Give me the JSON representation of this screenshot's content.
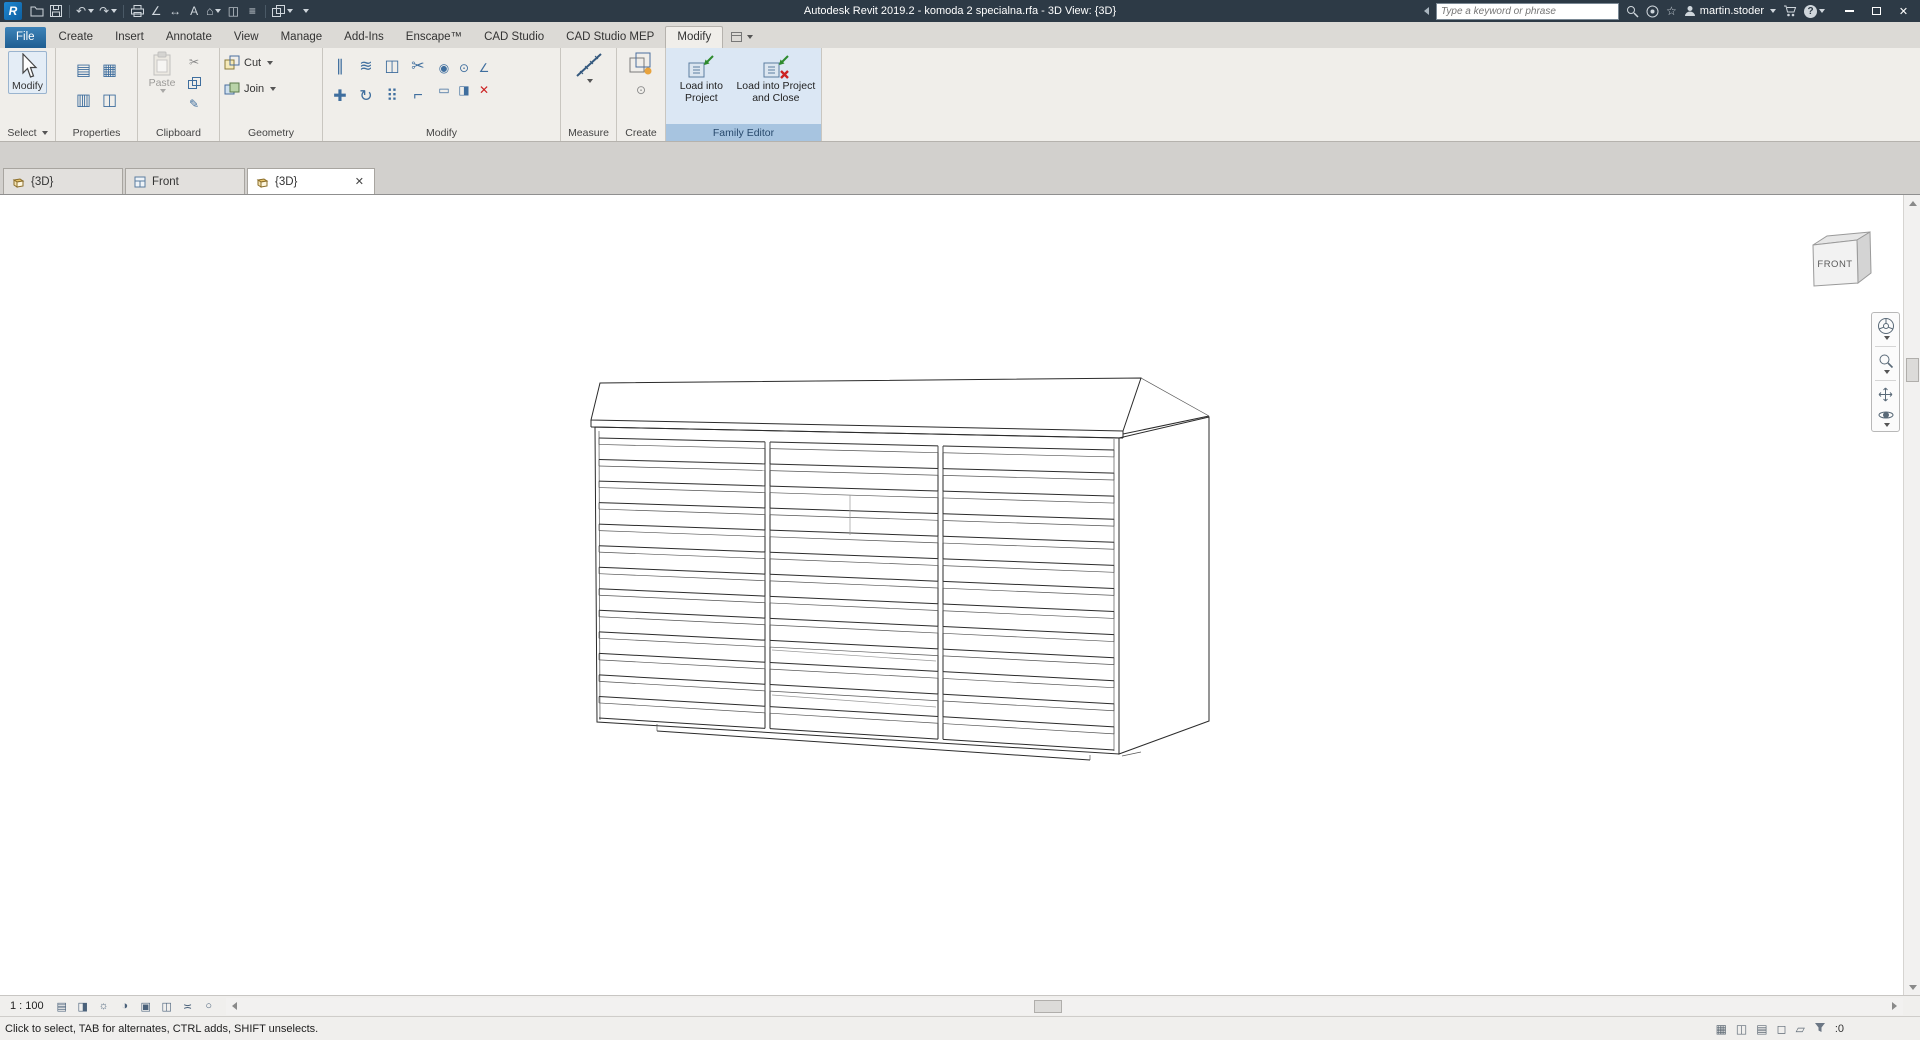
{
  "title_bar": {
    "logo": "R",
    "app_title": "Autodesk Revit 2019.2 - komoda 2 specialna.rfa - 3D View: {3D}",
    "search": {
      "placeholder": "Type a keyword or phrase"
    },
    "user": {
      "name": "martin.stoder"
    }
  },
  "icons": {
    "close": "✕",
    "help": "?"
  },
  "ribbon": {
    "tabs": [
      {
        "label": "File"
      },
      {
        "label": "Create"
      },
      {
        "label": "Insert"
      },
      {
        "label": "Annotate"
      },
      {
        "label": "View"
      },
      {
        "label": "Manage"
      },
      {
        "label": "Add-Ins"
      },
      {
        "label": "Enscape™"
      },
      {
        "label": "CAD Studio"
      },
      {
        "label": "CAD Studio MEP"
      },
      {
        "label": "Modify",
        "active": true
      }
    ],
    "select_panel": {
      "label": "Select",
      "modify_label": "Modify"
    },
    "properties_panel": {
      "label": "Properties"
    },
    "clipboard_panel": {
      "label": "Clipboard",
      "paste_label": "Paste"
    },
    "geometry_panel": {
      "label": "Geometry",
      "cut_label": "Cut",
      "join_label": "Join"
    },
    "modify_panel": {
      "label": "Modify"
    },
    "measure_panel": {
      "label": "Measure"
    },
    "create_panel": {
      "label": "Create"
    },
    "family_editor_panel": {
      "label": "Family Editor",
      "load_into_project": "Load into Project",
      "load_into_project_and_close": "Load into Project and Close"
    }
  },
  "view_tabs": [
    {
      "label": "{3D}"
    },
    {
      "label": "Front"
    },
    {
      "label": "{3D}",
      "active": true
    }
  ],
  "canvas": {
    "viewcube": {
      "front_label": "FRONT"
    },
    "drawing": {
      "object": "komoda (dresser) 3D wireframe",
      "drawer_columns": 3,
      "slats_per_column": 13
    }
  },
  "view_control_bar": {
    "scale": "1 : 100"
  },
  "status_bar": {
    "message": "Click to select, TAB for alternates, CTRL adds, SHIFT unselects.",
    "selection_count": ":0"
  }
}
